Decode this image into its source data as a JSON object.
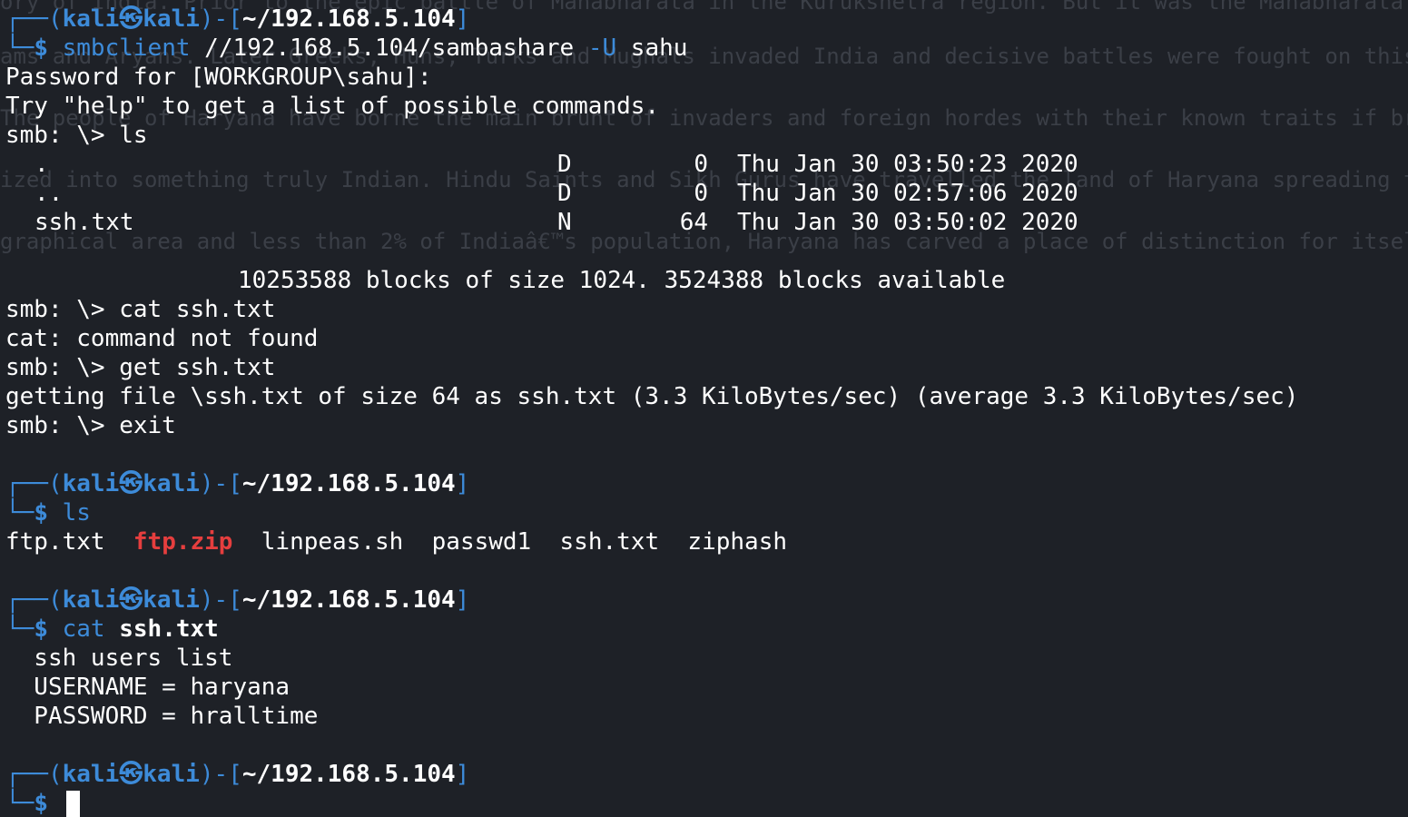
{
  "background_text": [
    "ory of India. Prior to the epic battle of Mahabharata in the Kurukshetra region. But it was the Mahabharata fought for the re",
    "ams and Aryans. Later Greeks, Huns, Turks and Mughals invaded India and decisive battles were fought on this land. At th",
    "The people of Haryana have borne the main brunt of invaders and foreign hordes with their known traits if bra",
    "ized into something truly Indian. Hindu Saints and Sikh Gurus have travelled the land of Haryana spreading th",
    "graphical area and less than 2% of Indiaâ€™s population, Haryana has carved a place of distinction for itsel"
  ],
  "prompt": {
    "corner_top": "┌──",
    "corner_bottom": "└─",
    "open_paren": "(",
    "user": "kali",
    "icon": "㉿",
    "host": "kali",
    "close_bracket_open": ")-[",
    "path": "~/192.168.5.104",
    "close_bracket": "]",
    "dollar": "$"
  },
  "block1": {
    "cmd_name": "smbclient",
    "cmd_arg1": "//192.168.5.104/sambashare",
    "cmd_flag": "-U",
    "cmd_arg2": "sahu",
    "output": [
      "Password for [WORKGROUP\\sahu]:",
      "Try \"help\" to get a list of possible commands.",
      "smb: \\> ls"
    ],
    "listing": [
      {
        "name": ".",
        "attr": "D",
        "size": "0",
        "date": "Thu Jan 30 03:50:23 2020"
      },
      {
        "name": "..",
        "attr": "D",
        "size": "0",
        "date": "Thu Jan 30 02:57:06 2020"
      },
      {
        "name": "ssh.txt",
        "attr": "N",
        "size": "64",
        "date": "Thu Jan 30 03:50:02 2020"
      }
    ],
    "blocks_line": "10253588 blocks of size 1024. 3524388 blocks available",
    "output2": [
      "smb: \\> cat ssh.txt",
      "cat: command not found",
      "smb: \\> get ssh.txt",
      "getting file \\ssh.txt of size 64 as ssh.txt (3.3 KiloBytes/sec) (average 3.3 KiloBytes/sec)",
      "smb: \\> exit"
    ]
  },
  "block2": {
    "cmd": "ls",
    "files": [
      "ftp.txt",
      "ftp.zip",
      "linpeas.sh",
      "passwd1",
      "ssh.txt",
      "ziphash"
    ]
  },
  "block3": {
    "cmd_name": "cat",
    "cmd_arg": "ssh.txt",
    "output": [
      "  ssh users list",
      "  USERNAME = haryana",
      "  PASSWORD = hralltime"
    ]
  },
  "colors": {
    "background": "#1e2127",
    "prompt_blue": "#3d8bd9",
    "archive_red": "#e53e3e",
    "text": "#ffffff"
  }
}
